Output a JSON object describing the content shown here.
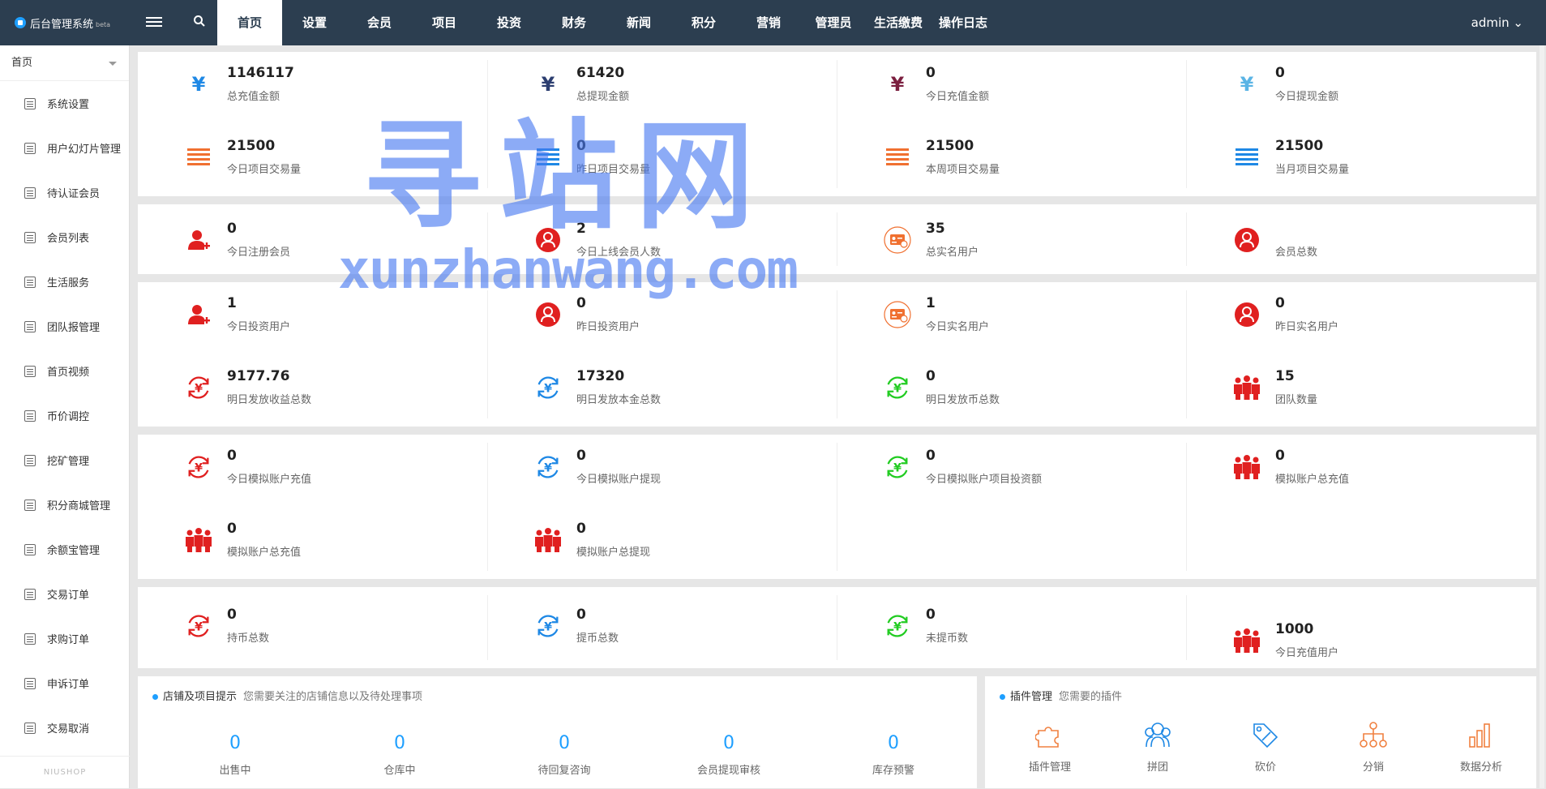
{
  "header": {
    "app_title": "后台管理系统",
    "beta": "beta",
    "nav": [
      "首页",
      "设置",
      "会员",
      "项目",
      "投资",
      "财务",
      "新闻",
      "积分",
      "营销",
      "管理员",
      "生活缴费",
      "操作日志"
    ],
    "user": "admin ⌄"
  },
  "sidebar": {
    "head": "首页",
    "items": [
      "系统设置",
      "用户幻灯片管理",
      "待认证会员",
      "会员列表",
      "生活服务",
      "团队报管理",
      "首页视频",
      "币价调控",
      "挖矿管理",
      "积分商城管理",
      "余额宝管理",
      "交易订单",
      "求购订单",
      "申诉订单",
      "交易取消"
    ],
    "footer": "NIUSHOP"
  },
  "stats": {
    "p1": [
      {
        "value": "1146117",
        "label": "总充值金额",
        "icon": "yen-icon",
        "color": "#1e88e5"
      },
      {
        "value": "61420",
        "label": "总提现金额",
        "icon": "yen-icon",
        "color": "#2c3e70"
      },
      {
        "value": "0",
        "label": "今日充值金额",
        "icon": "yen-icon",
        "color": "#7b1f3f"
      },
      {
        "value": "0",
        "label": "今日提现金额",
        "icon": "yen-icon",
        "color": "#5ab4e5"
      },
      {
        "value": "21500",
        "label": "今日项目交易量",
        "icon": "bars-icon",
        "color": "#f07030"
      },
      {
        "value": "0",
        "label": "昨日项目交易量",
        "icon": "bars-icon",
        "color": "#1e88e5"
      },
      {
        "value": "21500",
        "label": "本周项目交易量",
        "icon": "bars-icon",
        "color": "#f07030"
      },
      {
        "value": "21500",
        "label": "当月项目交易量",
        "icon": "bars-icon",
        "color": "#1e88e5"
      }
    ],
    "p2": [
      {
        "value": "0",
        "label": "今日注册会员",
        "icon": "user-add-icon",
        "color": "#e02020"
      },
      {
        "value": "2",
        "label": "今日上线会员人数",
        "icon": "user-circle-icon",
        "color": "#e02020"
      },
      {
        "value": "35",
        "label": "总实名用户",
        "icon": "id-card-icon",
        "color": "#f07030"
      },
      {
        "value": "",
        "label": "会员总数",
        "icon": "user-circle-icon",
        "color": "#e02020"
      }
    ],
    "p3": [
      {
        "value": "1",
        "label": "今日投资用户",
        "icon": "user-add-icon",
        "color": "#e02020"
      },
      {
        "value": "0",
        "label": "昨日投资用户",
        "icon": "user-circle-icon",
        "color": "#e02020"
      },
      {
        "value": "1",
        "label": "今日实名用户",
        "icon": "id-card-icon",
        "color": "#f07030"
      },
      {
        "value": "0",
        "label": "昨日实名用户",
        "icon": "user-circle-icon",
        "color": "#e02020"
      },
      {
        "value": "9177.76",
        "label": "明日发放收益总数",
        "icon": "yen-cycle-icon",
        "color": "#e02020"
      },
      {
        "value": "17320",
        "label": "明日发放本金总数",
        "icon": "yen-cycle-icon",
        "color": "#1e88e5"
      },
      {
        "value": "0",
        "label": "明日发放币总数",
        "icon": "yen-cycle-icon",
        "color": "#22cc22"
      },
      {
        "value": "15",
        "label": "团队数量",
        "icon": "team-icon",
        "color": "#e02020"
      }
    ],
    "p4": [
      {
        "value": "0",
        "label": "今日模拟账户充值",
        "icon": "yen-cycle-icon",
        "color": "#e02020"
      },
      {
        "value": "0",
        "label": "今日模拟账户提现",
        "icon": "yen-cycle-icon",
        "color": "#1e88e5"
      },
      {
        "value": "0",
        "label": "今日模拟账户项目投资额",
        "icon": "yen-cycle-icon",
        "color": "#22cc22"
      },
      {
        "value": "0",
        "label": "模拟账户总充值",
        "icon": "team-icon",
        "color": "#e02020"
      },
      {
        "value": "0",
        "label": "模拟账户总充值",
        "icon": "team-icon",
        "color": "#e02020"
      },
      {
        "value": "0",
        "label": "模拟账户总提现",
        "icon": "team-icon",
        "color": "#e02020"
      }
    ],
    "p5": [
      {
        "value": "0",
        "label": "持币总数",
        "icon": "yen-cycle-icon",
        "color": "#e02020"
      },
      {
        "value": "0",
        "label": "提币总数",
        "icon": "yen-cycle-icon",
        "color": "#1e88e5"
      },
      {
        "value": "0",
        "label": "未提币数",
        "icon": "yen-cycle-icon",
        "color": "#22cc22"
      },
      {
        "value": "1000",
        "label": "今日充值用户",
        "icon": "team-icon",
        "color": "#e02020"
      }
    ]
  },
  "shop": {
    "title": "店铺及项目提示",
    "subtitle": "您需要关注的店铺信息以及待处理事项",
    "items": [
      {
        "value": "0",
        "label": "出售中"
      },
      {
        "value": "0",
        "label": "仓库中"
      },
      {
        "value": "0",
        "label": "待回复咨询"
      },
      {
        "value": "0",
        "label": "会员提现审核"
      },
      {
        "value": "0",
        "label": "库存预警"
      }
    ]
  },
  "plugins": {
    "title": "插件管理",
    "subtitle": "您需要的插件",
    "items": [
      {
        "label": "插件管理",
        "icon": "puzzle-icon"
      },
      {
        "label": "拼团",
        "icon": "group-icon"
      },
      {
        "label": "砍价",
        "icon": "tag-icon"
      },
      {
        "label": "分销",
        "icon": "network-icon"
      },
      {
        "label": "数据分析",
        "icon": "chart-icon"
      }
    ]
  },
  "watermark": {
    "big": "寻站网",
    "small": "xunzhanwang.com"
  },
  "colors": {
    "topbar": "#2c3e50",
    "accent": "#1e9fff"
  }
}
